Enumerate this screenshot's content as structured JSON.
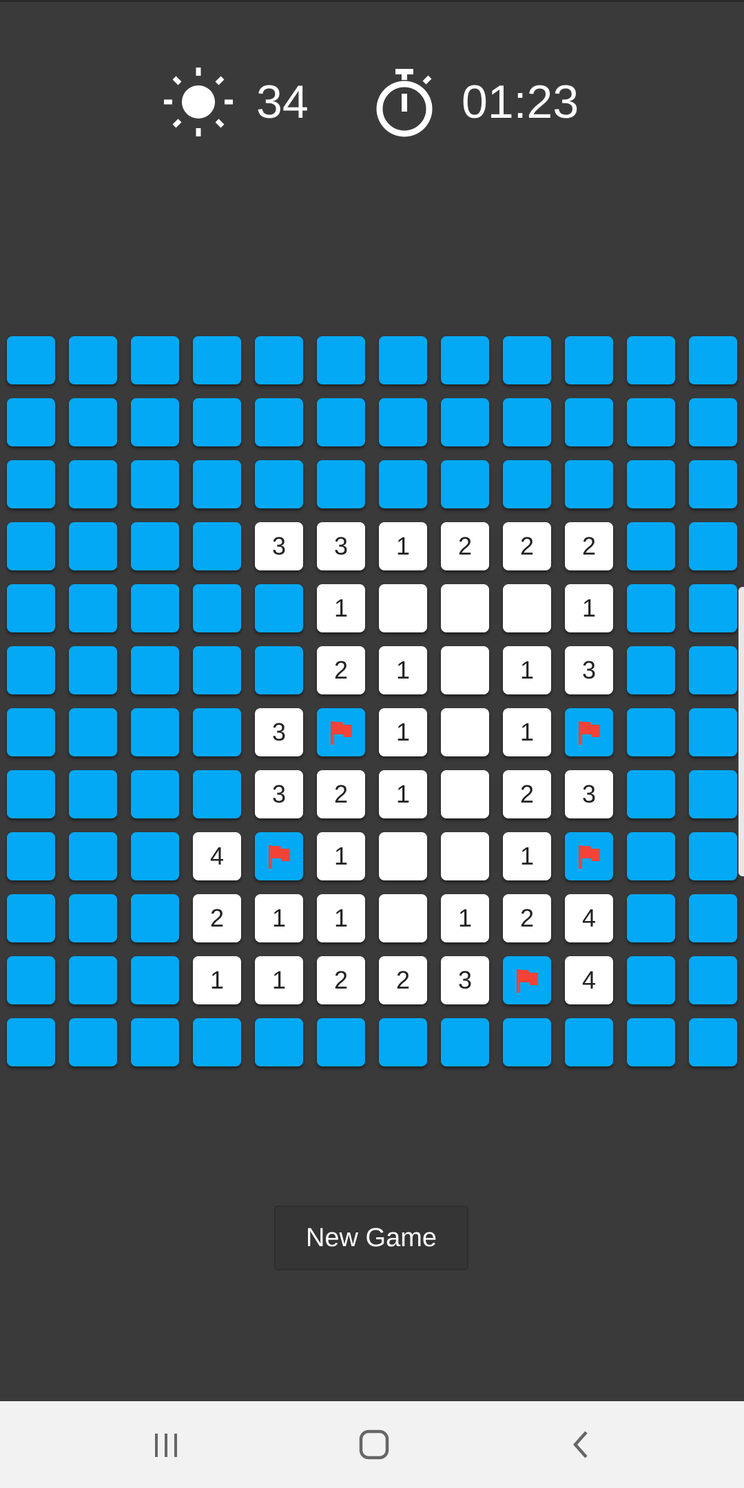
{
  "header": {
    "mines_remaining": "34",
    "timer": "01:23",
    "mine_icon": "sun-mine-icon",
    "timer_icon": "stopwatch-icon"
  },
  "board": {
    "rows": 12,
    "cols": 12,
    "legend": {
      "H": "hidden",
      "F": "flagged",
      "0": "revealed-empty",
      "1-8": "revealed-number"
    },
    "grid": [
      [
        "H",
        "H",
        "H",
        "H",
        "H",
        "H",
        "H",
        "H",
        "H",
        "H",
        "H",
        "H"
      ],
      [
        "H",
        "H",
        "H",
        "H",
        "H",
        "H",
        "H",
        "H",
        "H",
        "H",
        "H",
        "H"
      ],
      [
        "H",
        "H",
        "H",
        "H",
        "H",
        "H",
        "H",
        "H",
        "H",
        "H",
        "H",
        "H"
      ],
      [
        "H",
        "H",
        "H",
        "H",
        "3",
        "3",
        "1",
        "2",
        "2",
        "2",
        "H",
        "H"
      ],
      [
        "H",
        "H",
        "H",
        "H",
        "H",
        "1",
        "0",
        "0",
        "0",
        "1",
        "H",
        "H"
      ],
      [
        "H",
        "H",
        "H",
        "H",
        "H",
        "2",
        "1",
        "0",
        "1",
        "3",
        "H",
        "H"
      ],
      [
        "H",
        "H",
        "H",
        "H",
        "3",
        "F",
        "1",
        "0",
        "1",
        "F",
        "H",
        "H"
      ],
      [
        "H",
        "H",
        "H",
        "H",
        "3",
        "2",
        "1",
        "0",
        "2",
        "3",
        "H",
        "H"
      ],
      [
        "H",
        "H",
        "H",
        "4",
        "F",
        "1",
        "0",
        "0",
        "1",
        "F",
        "H",
        "H"
      ],
      [
        "H",
        "H",
        "H",
        "2",
        "1",
        "1",
        "0",
        "1",
        "2",
        "4",
        "H",
        "H"
      ],
      [
        "H",
        "H",
        "H",
        "1",
        "1",
        "2",
        "2",
        "3",
        "F",
        "4",
        "H",
        "H"
      ],
      [
        "H",
        "H",
        "H",
        "H",
        "H",
        "H",
        "H",
        "H",
        "H",
        "H",
        "H",
        "H"
      ]
    ]
  },
  "actions": {
    "new_game_label": "New Game"
  },
  "nav": {
    "recent_icon": "recent-apps-icon",
    "home_icon": "home-icon",
    "back_icon": "back-icon"
  },
  "colors": {
    "background": "#3a3a3a",
    "tile_hidden": "#03a9f4",
    "tile_open": "#ffffff",
    "flag": "#f44336",
    "nav_bar": "#f2f2f2"
  }
}
